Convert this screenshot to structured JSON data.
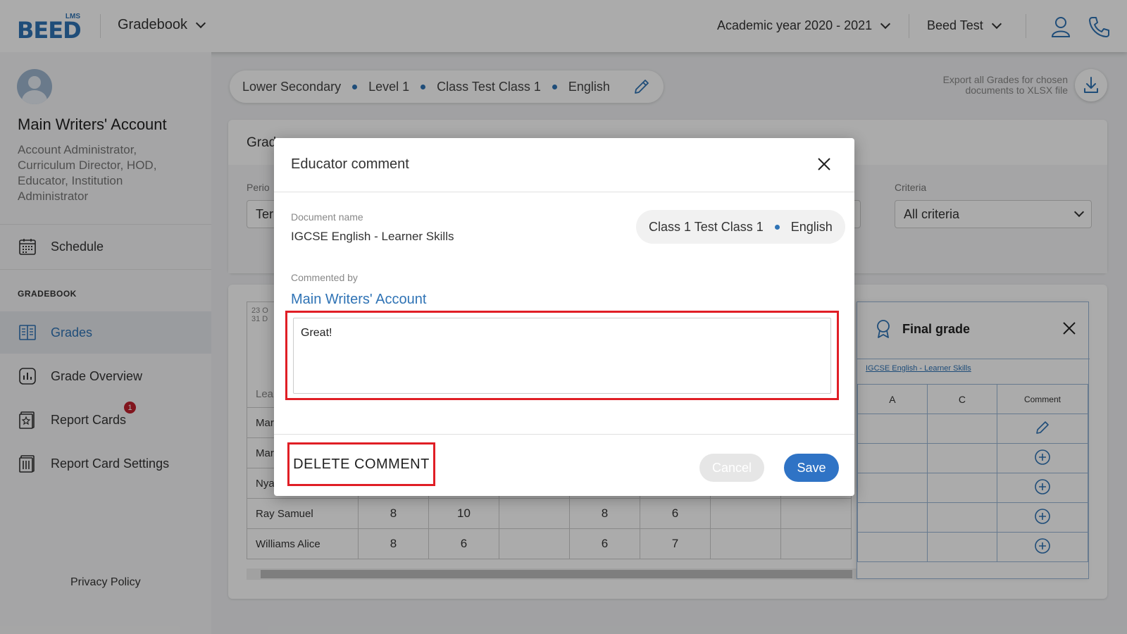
{
  "header": {
    "logo_small": "LMS",
    "logo_main": "BEED",
    "module": "Gradebook",
    "academic_year": "Academic year 2020 - 2021",
    "school": "Beed Test"
  },
  "sidebar": {
    "account_name": "Main Writers' Account",
    "account_roles": "Account Administrator, Curriculum Director, HOD, Educator, Institution Administrator",
    "schedule": "Schedule",
    "section": "GRADEBOOK",
    "items": [
      {
        "label": "Grades"
      },
      {
        "label": "Grade Overview"
      },
      {
        "label": "Report Cards",
        "badge": "1"
      },
      {
        "label": "Report Card Settings"
      }
    ],
    "privacy": "Privacy Policy"
  },
  "breadcrumb": [
    "Lower Secondary",
    "Level 1",
    "Class Test Class 1",
    "English"
  ],
  "export_text": "Export all Grades for chosen documents to XLSX file",
  "card": {
    "title": "Grad",
    "period_label": "Perio",
    "period_value": "Ter",
    "criteria_label": "Criteria",
    "criteria_value": "All criteria"
  },
  "table": {
    "header_dates": "23 O\n31 D",
    "header_learner": "Lea",
    "rows": [
      {
        "name": "Mar",
        "values": [
          "",
          "",
          "",
          "",
          "",
          "",
          ""
        ]
      },
      {
        "name": "Mar",
        "values": [
          "",
          "",
          "",
          "",
          "",
          "",
          ""
        ]
      },
      {
        "name": "Nya",
        "values": [
          "",
          "",
          "",
          "",
          "",
          "",
          ""
        ]
      },
      {
        "name": "Ray Samuel",
        "values": [
          "8",
          "10",
          "",
          "8",
          "6",
          "",
          ""
        ]
      },
      {
        "name": "Williams Alice",
        "values": [
          "8",
          "6",
          "",
          "6",
          "7",
          "",
          ""
        ]
      }
    ]
  },
  "final_grade": {
    "title": "Final grade",
    "doc_link": "IGCSE English - Learner Skills",
    "columns": [
      "A",
      "C",
      "Comment"
    ]
  },
  "modal": {
    "title": "Educator comment",
    "doc_label": "Document name",
    "doc_name": "IGCSE English - Learner Skills",
    "class_name": "Class 1 Test Class 1",
    "subject": "English",
    "commented_by_label": "Commented by",
    "author": "Main Writers' Account",
    "comment": "Great!",
    "delete_label": "DELETE COMMENT",
    "cancel_label": "Cancel",
    "save_label": "Save"
  },
  "colors": {
    "brand": "#2f73b5",
    "highlight": "#e01e25",
    "badge": "#c0202e"
  }
}
